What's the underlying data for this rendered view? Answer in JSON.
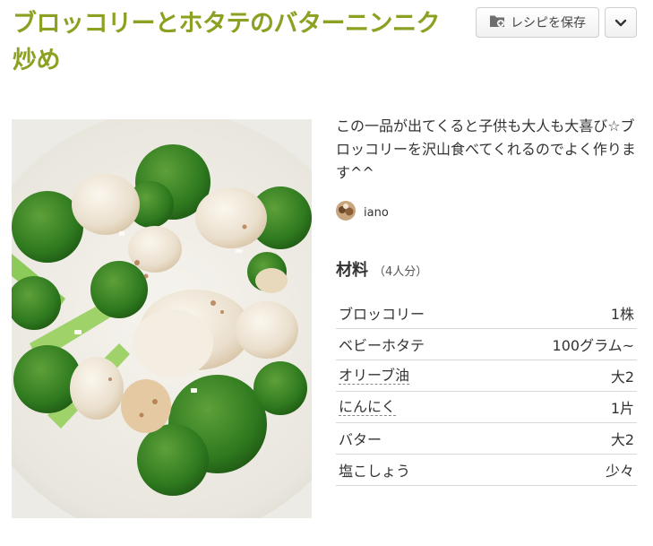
{
  "recipe": {
    "title": "ブロッコリーとホタテのバターニンニク炒め",
    "title_color": "#8ca121",
    "description": "この一品が出てくると子供も大人も大喜び☆ブロッコリーを沢山食べてくれるのでよく作ります^^",
    "photo_alt": "ブロッコリーとホタテのバターニンニク炒め"
  },
  "actions": {
    "save_label": "レシピを保存",
    "save_icon": "folder-add-icon",
    "menu_icon": "chevron-down-icon"
  },
  "author": {
    "name": "iano"
  },
  "ingredients": {
    "heading": "材料",
    "servings": "（4人分）",
    "items": [
      {
        "name": "ブロッコリー",
        "amount": "1株"
      },
      {
        "name": "ベビーホタテ",
        "amount": "100グラム~"
      },
      {
        "name": "オリーブ油",
        "amount": "大2"
      },
      {
        "name": "にんにく",
        "amount": "1片"
      },
      {
        "name": "バター",
        "amount": "大2"
      },
      {
        "name": "塩こしょう",
        "amount": "少々"
      }
    ]
  }
}
